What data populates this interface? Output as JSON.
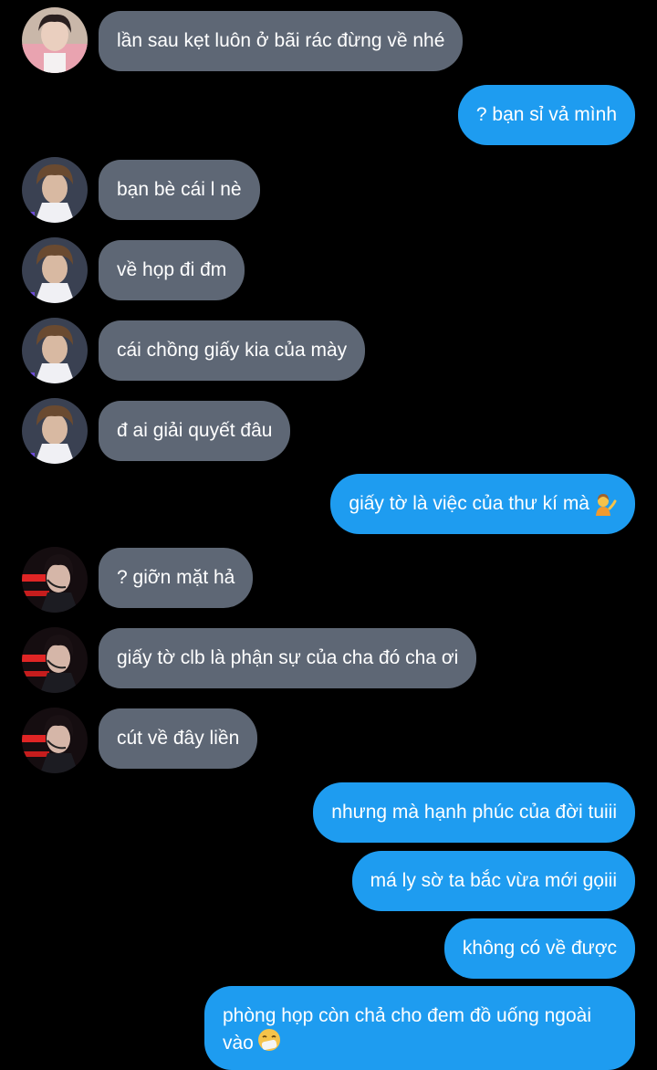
{
  "colors": {
    "background": "#000000",
    "received_bubble": "#5e6775",
    "sent_bubble": "#1e9cf0",
    "text": "#ffffff"
  },
  "messages": [
    {
      "side": "received",
      "avatar": "avatar-user-a",
      "text": "lần sau kẹt luôn ở bãi rác đừng về nhé"
    },
    {
      "side": "sent",
      "text": "? bạn sỉ vả mình"
    },
    {
      "side": "received",
      "avatar": "avatar-user-b",
      "text": "bạn bè cái l nè"
    },
    {
      "side": "received",
      "avatar": "avatar-user-b",
      "text": "về họp đi đm"
    },
    {
      "side": "received",
      "avatar": "avatar-user-b",
      "text": "cái chồng giấy kia của mày"
    },
    {
      "side": "received",
      "avatar": "avatar-user-b",
      "text": "đ ai giải quyết đâu"
    },
    {
      "side": "sent",
      "text": "giấy tờ là việc của thư kí mà",
      "emoji": "person-tipping-hand-emoji"
    },
    {
      "side": "received",
      "avatar": "avatar-user-c",
      "text": "? giỡn mặt hả"
    },
    {
      "side": "received",
      "avatar": "avatar-user-c",
      "text": "giấy tờ clb là phận sự của cha đó cha ơi"
    },
    {
      "side": "received",
      "avatar": "avatar-user-c",
      "text": "cút về đây liền"
    },
    {
      "side": "sent",
      "text": "nhưng mà hạnh phúc của đời tuiii"
    },
    {
      "side": "sent",
      "text": "má ly sờ ta bắc vừa mới gọiii"
    },
    {
      "side": "sent",
      "text": "không có về được"
    },
    {
      "side": "sent",
      "text": "phòng họp còn chả cho đem đồ uống ngoài vào",
      "emoji": "sneezing-face-emoji"
    }
  ]
}
